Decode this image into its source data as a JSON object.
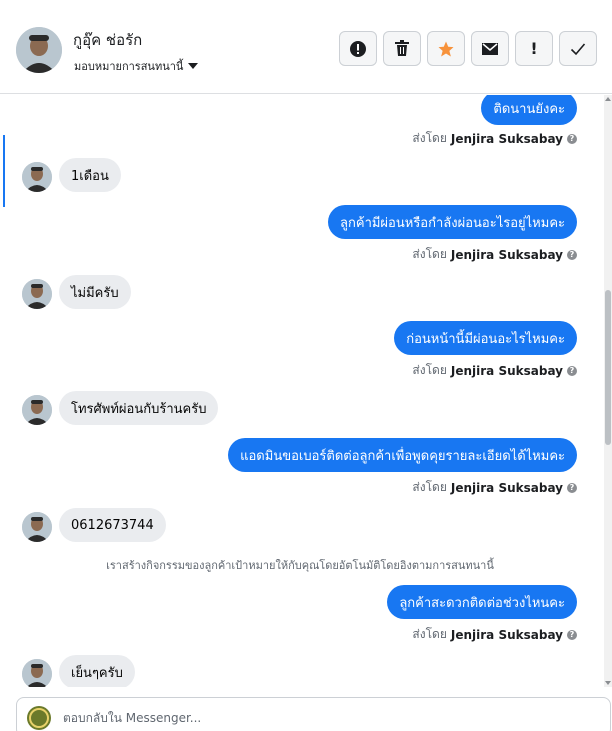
{
  "header": {
    "contact_name": "กูอุ๊ค ช่อรัก",
    "assign_label": "มอบหมายการสนทนานี้",
    "toolbar": [
      {
        "name": "report-button",
        "icon": "exclamation-circle-icon",
        "glyph": "●"
      },
      {
        "name": "delete-button",
        "icon": "trash-icon",
        "glyph": "🗑"
      },
      {
        "name": "star-button",
        "icon": "star-icon",
        "glyph": "★"
      },
      {
        "name": "mark-unread-button",
        "icon": "envelope-icon",
        "glyph": "✉"
      },
      {
        "name": "flag-button",
        "icon": "exclamation-icon",
        "glyph": "!"
      },
      {
        "name": "done-button",
        "icon": "check-icon",
        "glyph": "✓"
      }
    ]
  },
  "messages": [
    {
      "type": "out",
      "text": "ติดนานยังคะ",
      "sent_by_prefix": "ส่งโดย",
      "sent_by": "Jenjira Suksabay"
    },
    {
      "type": "in",
      "text": "1เดือน"
    },
    {
      "type": "out",
      "text": "ลูกค้ามีผ่อนหรือกำลังผ่อนอะไรอยู่ไหมคะ",
      "sent_by_prefix": "ส่งโดย",
      "sent_by": "Jenjira Suksabay"
    },
    {
      "type": "in",
      "text": "ไม่มีครับ"
    },
    {
      "type": "out",
      "text": "ก่อนหน้านี้มีผ่อนอะไรไหมคะ",
      "sent_by_prefix": "ส่งโดย",
      "sent_by": "Jenjira Suksabay"
    },
    {
      "type": "in",
      "text": "โทรศัพท์ผ่อนกับร้านครับ"
    },
    {
      "type": "out",
      "text": "แอดมินขอเบอร์ติดต่อลูกค้าเพื่อพูดคุยรายละเอียดได้ไหมคะ",
      "sent_by_prefix": "ส่งโดย",
      "sent_by": "Jenjira Suksabay"
    },
    {
      "type": "in",
      "text": "0612673744"
    },
    {
      "type": "system",
      "text": "เราสร้างกิจกรรมของลูกค้าเป้าหมายให้กับคุณโดยอัตโนมัติโดยอิงตามการสนทนานี้"
    },
    {
      "type": "out",
      "text": "ลูกค้าสะดวกติดต่อช่วงไหนคะ",
      "sent_by_prefix": "ส่งโดย",
      "sent_by": "Jenjira Suksabay"
    },
    {
      "type": "in",
      "text": "เย็นๆครับ"
    }
  ],
  "composer": {
    "placeholder": "ตอบกลับใน Messenger..."
  },
  "colors": {
    "accent": "#1877f2",
    "incoming_bubble": "#eaecef",
    "star": "#f7923b"
  }
}
